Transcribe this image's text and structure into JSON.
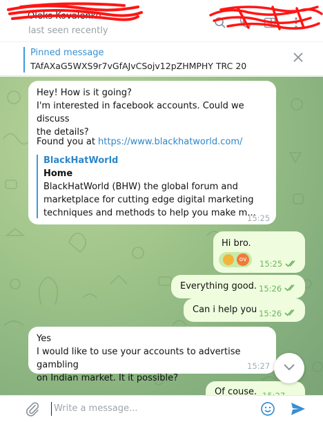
{
  "header": {
    "contact_name": "Oleks Kovalenko",
    "status": "last seen recently",
    "icons": [
      "search-icon",
      "phone-icon",
      "sidebar-icon",
      "more-icon"
    ]
  },
  "pinned": {
    "title": "Pinned message",
    "text": "TAfAXaG5WXS9r7vGfAJvCSojv12pZHMPHY TRC 20"
  },
  "messages": [
    {
      "direction": "in",
      "lines": [
        "Hey! How is it going?",
        "I'm interested in facebook accounts. Could we discuss",
        "the details?"
      ],
      "found_prefix": "Found you at ",
      "found_link": "https://www.blackhatworld.com/",
      "preview": {
        "site": "BlackHatWorld",
        "title": "Home",
        "lines": [
          "BlackHatWorld (BHW) the global forum and",
          "marketplace for cutting edge digital marketing",
          "techniques and methods to help you make m..."
        ]
      },
      "time": "15:25"
    },
    {
      "direction": "out",
      "text": "Hi bro.",
      "reactions": [
        "handshake",
        "ov"
      ],
      "time": "15:25"
    },
    {
      "direction": "out",
      "text": "Everything good.",
      "time": "15:26"
    },
    {
      "direction": "out",
      "text": "Can i help you",
      "time": "15:26"
    },
    {
      "direction": "in",
      "lines": [
        "Yes",
        "I would like to use your accounts to advertise gambling",
        "on Indian market. It it possible?"
      ],
      "time": "15:27"
    },
    {
      "direction": "out",
      "text": "Of couse.",
      "time": "15:27"
    }
  ],
  "composer": {
    "placeholder": "Write a message..."
  },
  "colors": {
    "accent": "#3a8fd0",
    "outgoing_bubble": "#effdde",
    "read_check": "#6cb35d",
    "chat_background": "#9ec389"
  }
}
